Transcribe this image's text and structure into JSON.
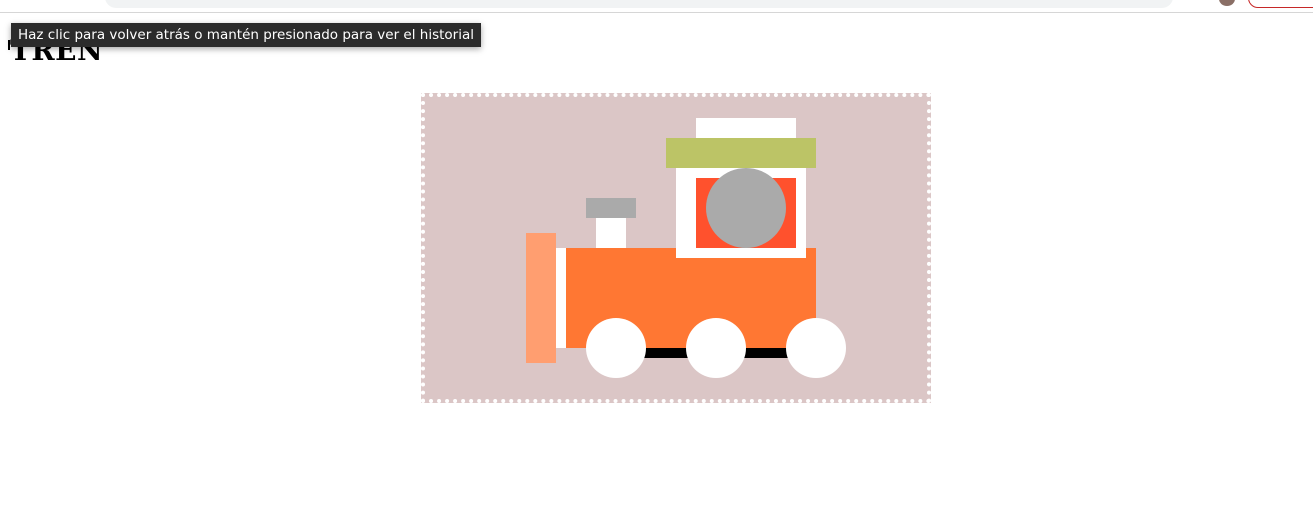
{
  "page": {
    "title": "TREN"
  },
  "tooltip": {
    "text": "Haz clic para volver atrás o mantén presionado para ver el historial"
  },
  "colors": {
    "canvas_background": "#dbc6c6",
    "canvas_border": "#ffffff",
    "boiler": "#ff7733",
    "buffer": "#ff9e70",
    "roof": "#bcc466",
    "window": "#ff512d",
    "chimney_cap": "#aaaaaa",
    "driver": "#aaaaaa",
    "wheels": "#ffffff",
    "axle": "#000000"
  }
}
